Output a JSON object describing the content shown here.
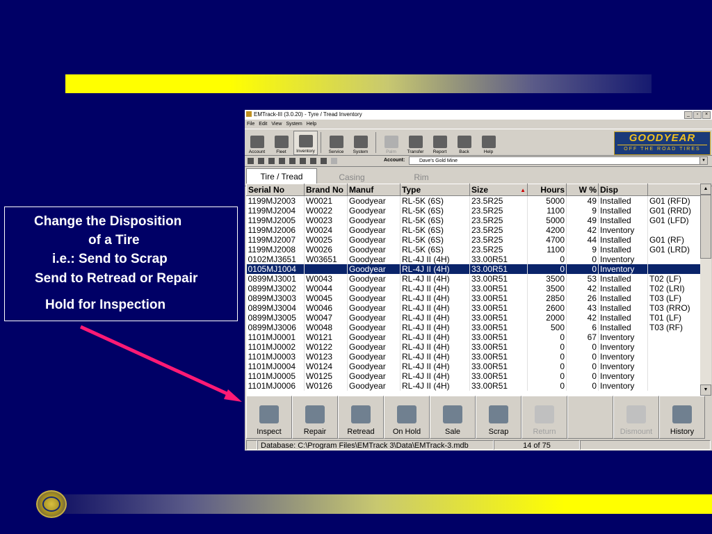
{
  "callout": {
    "line1": "Change the Disposition",
    "line2": "of a Tire",
    "line3": "i.e.: Send to Scrap",
    "line4": "Send to Retread or Repair",
    "line5": "Hold for Inspection"
  },
  "window": {
    "title": "EMTrack-III (3.0.20) - Tyre / Tread Inventory",
    "controls": {
      "minimize": "_",
      "restore": "▫",
      "close": "×"
    }
  },
  "menu": [
    "File",
    "Edit",
    "View",
    "System",
    "Help"
  ],
  "toolbar": {
    "buttons": [
      "Account",
      "Fleet",
      "Inventory",
      "Service",
      "System",
      "Palm",
      "Transfer",
      "Report",
      "Back",
      "Help"
    ],
    "active": "Inventory",
    "disabled": [
      "Palm"
    ]
  },
  "brand": {
    "name": "GOODYEAR",
    "tagline": "OFF THE ROAD TIRES"
  },
  "account": {
    "label": "Account:",
    "value": "Dave's Gold Mine"
  },
  "tabs": [
    "Tire / Tread",
    "Casing",
    "Rim"
  ],
  "grid": {
    "headers": [
      "Serial No",
      "Brand No",
      "Manuf",
      "Type",
      "Size",
      "Hours",
      "W %",
      "Disp",
      ""
    ],
    "sort_arrow": "▲",
    "selected_row": 7,
    "rows": [
      [
        "1199MJ2003",
        "W0021",
        "Goodyear",
        "RL-5K (6S)",
        "23.5R25",
        "5000",
        "49",
        "Installed",
        "G01 (RFD)"
      ],
      [
        "1199MJ2004",
        "W0022",
        "Goodyear",
        "RL-5K (6S)",
        "23.5R25",
        "1100",
        "9",
        "Installed",
        "G01 (RRD)"
      ],
      [
        "1199MJ2005",
        "W0023",
        "Goodyear",
        "RL-5K (6S)",
        "23.5R25",
        "5000",
        "49",
        "Installed",
        "G01 (LFD)"
      ],
      [
        "1199MJ2006",
        "W0024",
        "Goodyear",
        "RL-5K (6S)",
        "23.5R25",
        "4200",
        "42",
        "Inventory",
        ""
      ],
      [
        "1199MJ2007",
        "W0025",
        "Goodyear",
        "RL-5K (6S)",
        "23.5R25",
        "4700",
        "44",
        "Installed",
        "G01 (RF)"
      ],
      [
        "1199MJ2008",
        "W0026",
        "Goodyear",
        "RL-5K (6S)",
        "23.5R25",
        "1100",
        "9",
        "Installed",
        "G01 (LRD)"
      ],
      [
        "0102MJ3651",
        "W03651",
        "Goodyear",
        "RL-4J II (4H)",
        "33.00R51",
        "0",
        "0",
        "Inventory",
        ""
      ],
      [
        "0105MJ1004",
        "",
        "Goodyear",
        "RL-4J II (4H)",
        "33.00R51",
        "0",
        "0",
        "Inventory",
        ""
      ],
      [
        "0899MJ3001",
        "W0043",
        "Goodyear",
        "RL-4J II (4H)",
        "33.00R51",
        "3500",
        "53",
        "Installed",
        "T02 (LF)"
      ],
      [
        "0899MJ3002",
        "W0044",
        "Goodyear",
        "RL-4J II (4H)",
        "33.00R51",
        "3500",
        "42",
        "Installed",
        "T02 (LRI)"
      ],
      [
        "0899MJ3003",
        "W0045",
        "Goodyear",
        "RL-4J II (4H)",
        "33.00R51",
        "2850",
        "26",
        "Installed",
        "T03 (LF)"
      ],
      [
        "0899MJ3004",
        "W0046",
        "Goodyear",
        "RL-4J II (4H)",
        "33.00R51",
        "2600",
        "43",
        "Installed",
        "T03 (RRO)"
      ],
      [
        "0899MJ3005",
        "W0047",
        "Goodyear",
        "RL-4J II (4H)",
        "33.00R51",
        "2000",
        "42",
        "Installed",
        "T01 (LF)"
      ],
      [
        "0899MJ3006",
        "W0048",
        "Goodyear",
        "RL-4J II (4H)",
        "33.00R51",
        "500",
        "6",
        "Installed",
        "T03 (RF)"
      ],
      [
        "1101MJ0001",
        "W0121",
        "Goodyear",
        "RL-4J II (4H)",
        "33.00R51",
        "0",
        "67",
        "Inventory",
        ""
      ],
      [
        "1101MJ0002",
        "W0122",
        "Goodyear",
        "RL-4J II (4H)",
        "33.00R51",
        "0",
        "0",
        "Inventory",
        ""
      ],
      [
        "1101MJ0003",
        "W0123",
        "Goodyear",
        "RL-4J II (4H)",
        "33.00R51",
        "0",
        "0",
        "Inventory",
        ""
      ],
      [
        "1101MJ0004",
        "W0124",
        "Goodyear",
        "RL-4J II (4H)",
        "33.00R51",
        "0",
        "0",
        "Inventory",
        ""
      ],
      [
        "1101MJ0005",
        "W0125",
        "Goodyear",
        "RL-4J II (4H)",
        "33.00R51",
        "0",
        "0",
        "Inventory",
        ""
      ],
      [
        "1101MJ0006",
        "W0126",
        "Goodyear",
        "RL-4J II (4H)",
        "33.00R51",
        "0",
        "0",
        "Inventory",
        ""
      ]
    ]
  },
  "actions": {
    "buttons": [
      "Inspect",
      "Repair",
      "Retread",
      "On Hold",
      "Sale",
      "Scrap",
      "Return",
      "",
      "Dismount",
      "History"
    ],
    "disabled": [
      "Return",
      "Dismount"
    ]
  },
  "status": {
    "database": "Database: C:\\Program Files\\EMTrack 3\\Data\\EMTrack-3.mdb",
    "record": "14 of 75"
  },
  "colors": {
    "background": "#000066",
    "selection": "#0a246a",
    "arrow": "#ff1a75"
  }
}
